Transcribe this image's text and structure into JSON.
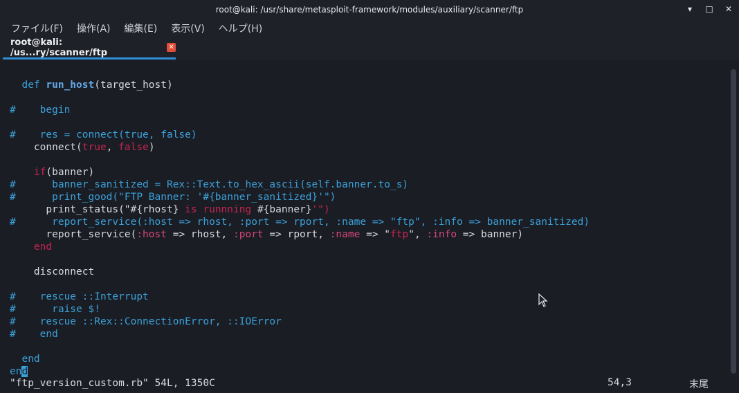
{
  "window": {
    "title": "root@kali: /usr/share/metasploit-framework/modules/auxiliary/scanner/ftp",
    "minimize": "▾",
    "maximize": "□",
    "close": "✕"
  },
  "menu": [
    "ファイル(F)",
    "操作(A)",
    "編集(E)",
    "表示(V)",
    "ヘルプ(H)"
  ],
  "tab": {
    "label": "root@kali: /us...ry/scanner/ftp",
    "close": "✕"
  },
  "code": {
    "l1_def": "def ",
    "l1_name": "run_host",
    "l1_rest": "(target_host)",
    "l2": "#    begin",
    "l3": "#    res = connect(true, false)",
    "l4_a": "    connect(",
    "l4_true": "true",
    "l4_comma": ", ",
    "l4_false": "false",
    "l4_close": ")",
    "l5_if": "    if",
    "l5_rest": "(banner)",
    "l6": "#      banner_sanitized = Rex::Text.to_hex_ascii(self.banner.to_s)",
    "l7": "#      print_good(\"FTP Banner: '#{banner_sanitized}'\")",
    "l8_a": "      print_status(\"#{rhost} ",
    "l8_b": "is runnning ",
    "l8_c": "#{banner}",
    "l8_d": "'\")",
    "l9": "#      report_service(:host => rhost, :port => rport, :name => \"ftp\", :info => banner_sanitized)",
    "l10_a": "      report_service(",
    "l10_host": ":host",
    "l10_b": " => rhost, ",
    "l10_port": ":port",
    "l10_c": " => rport, ",
    "l10_name": ":name",
    "l10_d": " => \"",
    "l10_ftp": "ftp",
    "l10_e": "\", ",
    "l10_info": ":info",
    "l10_f": " => banner)",
    "l11": "    end",
    "l12": "    disconnect",
    "l13": "#    rescue ::Interrupt",
    "l14": "#      raise $!",
    "l15": "#    rescue ::Rex::ConnectionError, ::IOError",
    "l16": "#    end",
    "l17": "  end",
    "l18_a": "en",
    "l18_b": "d"
  },
  "status": {
    "file": "\"ftp_version_custom.rb\" 54L, 1350C",
    "position": "54,3",
    "scroll": "末尾"
  },
  "colors": {
    "accent": "#2f8fd8",
    "comment": "#3aa0d8",
    "keyword_red": "#c4254f"
  }
}
